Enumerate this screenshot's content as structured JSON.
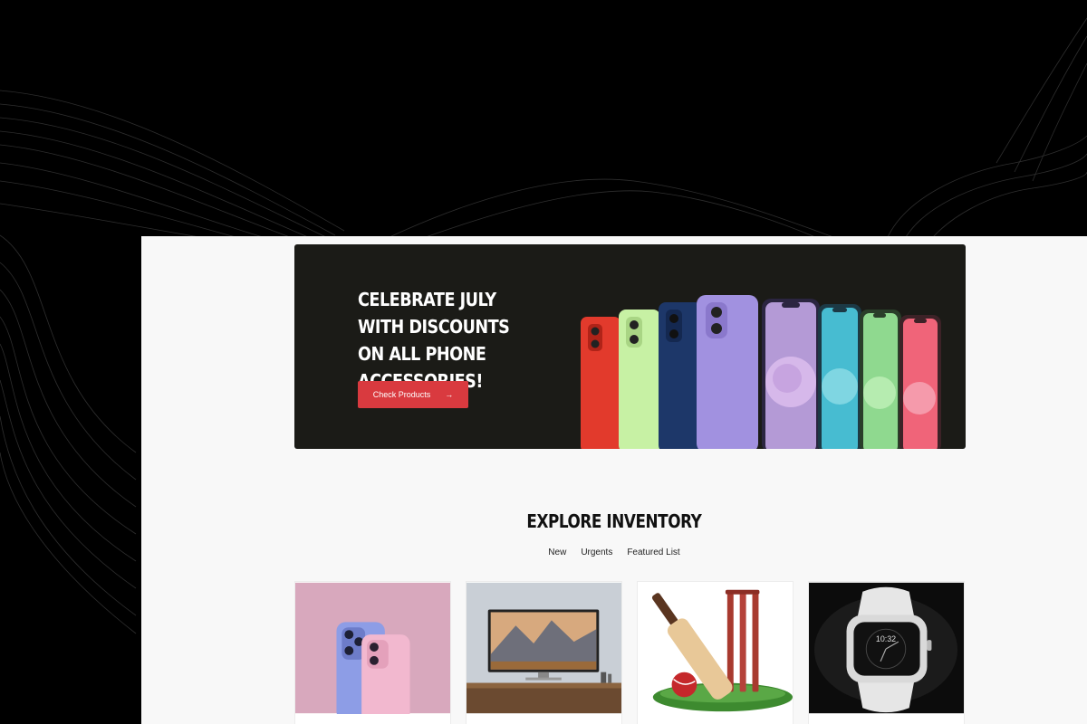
{
  "hero": {
    "title": "CELEBRATE JULY WITH DISCOUNTS ON ALL PHONE ACCESSORIES!",
    "button_label": "Check Products",
    "button_icon": "arrow-right-icon",
    "button_arrow": "→",
    "button_color": "#d93a3f"
  },
  "inventory": {
    "title": "EXPLORE INVENTORY",
    "tabs": [
      {
        "label": "New"
      },
      {
        "label": "Urgents"
      },
      {
        "label": "Featured List"
      }
    ],
    "products": [
      {
        "image": "smartphones-image"
      },
      {
        "image": "television-image"
      },
      {
        "image": "cricket-bat-image"
      },
      {
        "image": "smartwatch-image"
      }
    ]
  },
  "product_watch": {
    "time": "10:32"
  }
}
